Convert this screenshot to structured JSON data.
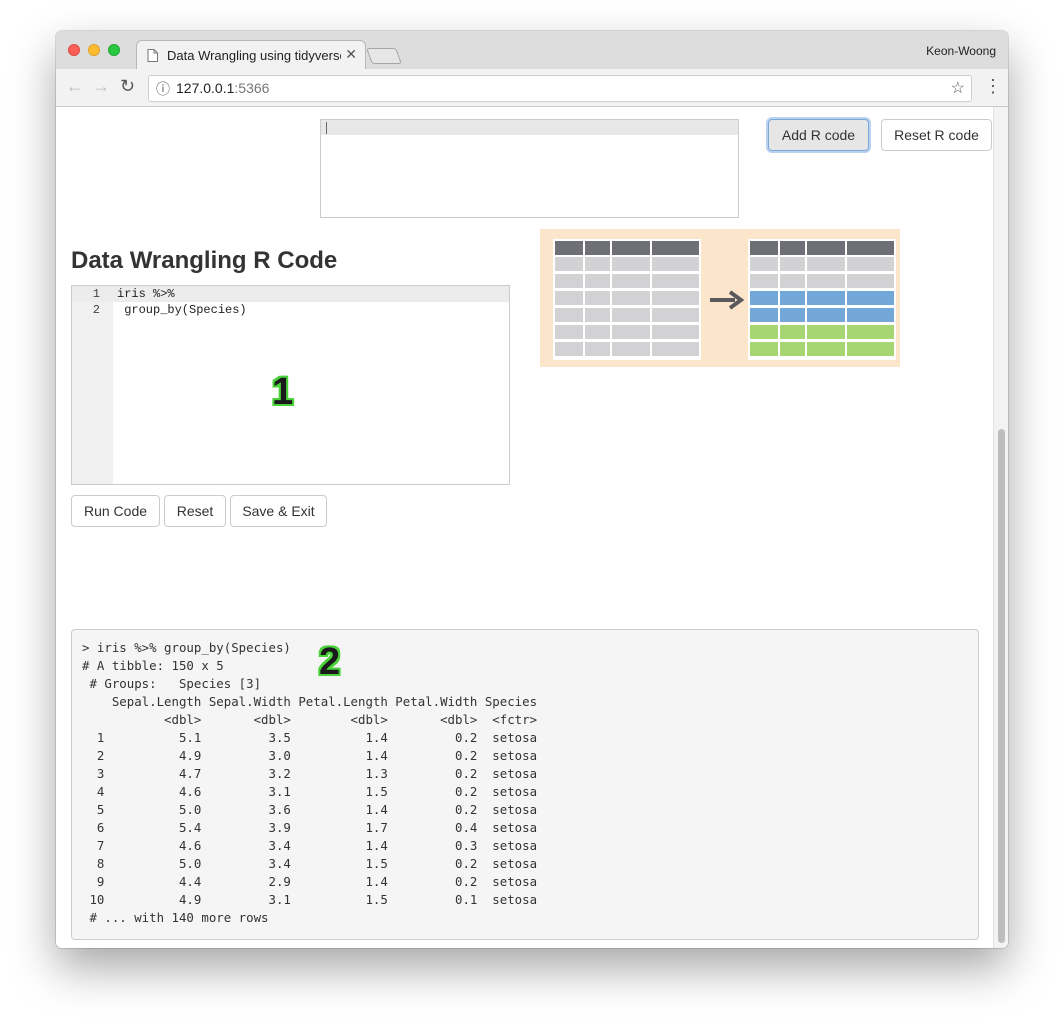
{
  "browser": {
    "tab_title": "Data Wrangling using tidyverse",
    "profile_name": "Keon-Woong",
    "url_host": "127.0.0.1",
    "url_port": ":5366",
    "back_glyph": "←",
    "forward_glyph": "→",
    "reload_glyph": "↻",
    "info_glyph": "ⓘ",
    "star_glyph": "☆",
    "menu_glyph": "⋮",
    "close_glyph": "✕"
  },
  "top_buttons": {
    "add_label": "Add R code",
    "reset_label": "Reset R code"
  },
  "editor": {
    "heading": "Data Wrangling R Code",
    "lines": [
      {
        "num": "1",
        "code": "iris %>%"
      },
      {
        "num": "2",
        "code": " group_by(Species)"
      }
    ]
  },
  "action_buttons": {
    "run_label": "Run Code",
    "reset_label": "Reset",
    "save_label": "Save & Exit"
  },
  "annotations": {
    "one": "1",
    "two": "2"
  },
  "output": {
    "text": "> iris %>% group_by(Species)\n# A tibble: 150 x 5\n # Groups:   Species [3]\n    Sepal.Length Sepal.Width Petal.Length Petal.Width Species\n           <dbl>       <dbl>        <dbl>       <dbl>  <fctr>\n  1          5.1         3.5          1.4         0.2  setosa\n  2          4.9         3.0          1.4         0.2  setosa\n  3          4.7         3.2          1.3         0.2  setosa\n  4          4.6         3.1          1.5         0.2  setosa\n  5          5.0         3.6          1.4         0.2  setosa\n  6          5.4         3.9          1.7         0.4  setosa\n  7          4.6         3.4          1.4         0.3  setosa\n  8          5.0         3.4          1.5         0.2  setosa\n  9          4.4         2.9          1.4         0.2  setosa\n 10          4.9         3.1          1.5         0.1  setosa\n # ... with 140 more rows"
  },
  "colors": {
    "illustration_bg": "#fce6cb",
    "header_cell": "#6f7077",
    "plain_cell": "#d2d2d4",
    "group_blue": "#72a7d8",
    "group_green": "#a6d672",
    "annotation_outline": "#4bd13a"
  }
}
